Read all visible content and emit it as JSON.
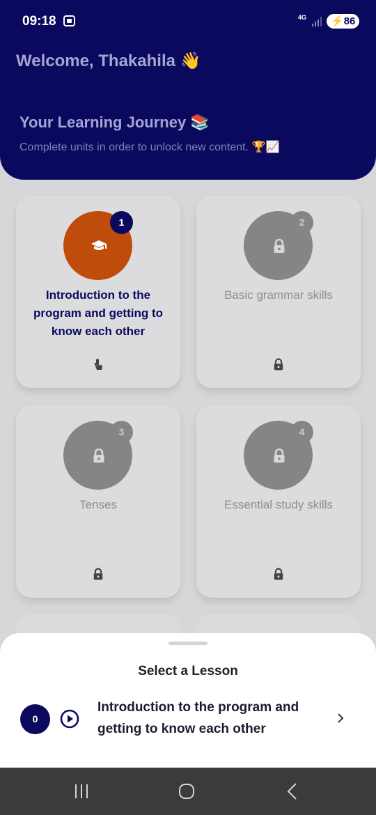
{
  "status_bar": {
    "time": "09:18",
    "network": "4G",
    "battery": "86"
  },
  "header": {
    "welcome": "Welcome, Thakahila 👋",
    "journey_title": "Your Learning Journey 📚",
    "journey_subtitle": "Complete units in order to unlock new content. 🏆📈"
  },
  "units": [
    {
      "number": "1",
      "title": "Introduction to the program and getting to know each other",
      "state": "active",
      "icon": "graduation-cap-icon",
      "bottom_icon": "tap-icon"
    },
    {
      "number": "2",
      "title": "Basic grammar skills",
      "state": "locked",
      "icon": "lock-icon",
      "bottom_icon": "lock-icon"
    },
    {
      "number": "3",
      "title": "Tenses",
      "state": "locked",
      "icon": "lock-icon",
      "bottom_icon": "lock-icon"
    },
    {
      "number": "4",
      "title": "Essential study skills",
      "state": "locked",
      "icon": "lock-icon",
      "bottom_icon": "lock-icon"
    }
  ],
  "sheet": {
    "title": "Select a Lesson",
    "lessons": [
      {
        "number": "0",
        "title": "Introduction to the program and getting to know each other"
      }
    ]
  },
  "colors": {
    "primary": "#0a095e",
    "accent": "#bf4c0b",
    "locked": "#858585"
  }
}
